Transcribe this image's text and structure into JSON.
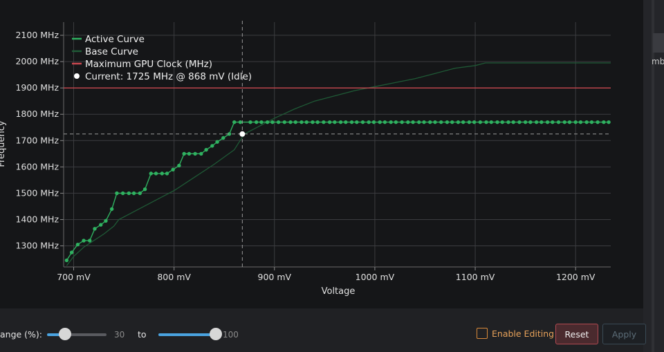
{
  "chart_data": {
    "type": "line",
    "xlabel": "Voltage",
    "ylabel": "Frequency",
    "x_unit": "mV",
    "y_unit": "MHz",
    "xlim": [
      690,
      1235
    ],
    "ylim": [
      1220,
      2150
    ],
    "x_ticks": [
      700,
      800,
      900,
      1000,
      1100,
      1200
    ],
    "y_ticks": [
      1300,
      1400,
      1500,
      1600,
      1700,
      1800,
      1900,
      2000,
      2100
    ],
    "x_tick_labels": [
      "700 mV",
      "800 mV",
      "900 mV",
      "1000 mV",
      "1100 mV",
      "1200 mV"
    ],
    "y_tick_labels": [
      "1300 MHz",
      "1400 MHz",
      "1500 MHz",
      "1600 MHz",
      "1700 MHz",
      "1800 MHz",
      "1900 MHz",
      "2000 MHz",
      "2100 MHz"
    ],
    "grid": true,
    "legend_position": "top-left",
    "legend": [
      {
        "label": "Active Curve",
        "color": "#2fb160"
      },
      {
        "label": "Base Curve",
        "color": "#1f5a36"
      },
      {
        "label": "Maximum GPU Clock (MHz)",
        "color": "#c9474f"
      },
      {
        "label": "Current: 1725 MHz @ 868 mV (Idle)",
        "color": "#ffffff"
      }
    ],
    "series": [
      {
        "name": "Active Curve",
        "color": "#2fb160",
        "x": [
          693,
          698,
          704,
          710,
          716,
          721,
          727,
          732,
          738,
          743,
          749,
          755,
          760,
          766,
          771,
          777,
          782,
          788,
          793,
          799,
          805,
          810,
          815,
          821,
          827,
          832,
          838,
          843,
          849,
          855,
          860,
          866,
          876,
          882,
          887,
          893,
          898,
          904,
          910,
          916,
          921,
          927,
          932,
          938,
          943,
          949,
          955,
          960,
          966,
          971,
          977,
          982,
          988,
          994,
          999,
          1005,
          1010,
          1016,
          1021,
          1027,
          1033,
          1038,
          1044,
          1049,
          1055,
          1060,
          1066,
          1072,
          1077,
          1083,
          1088,
          1094,
          1099,
          1105,
          1111,
          1116,
          1122,
          1127,
          1133,
          1138,
          1144,
          1150,
          1155,
          1161,
          1166,
          1172,
          1177,
          1183,
          1189,
          1194,
          1200,
          1205,
          1211,
          1216,
          1222,
          1228,
          1233
        ],
        "y": [
          1245,
          1275,
          1305,
          1320,
          1320,
          1365,
          1380,
          1395,
          1440,
          1500,
          1500,
          1500,
          1500,
          1500,
          1515,
          1575,
          1575,
          1575,
          1575,
          1590,
          1605,
          1650,
          1650,
          1650,
          1650,
          1665,
          1680,
          1695,
          1710,
          1725,
          1770,
          1770,
          1770,
          1770,
          1770,
          1770,
          1770,
          1770,
          1770,
          1770,
          1770,
          1770,
          1770,
          1770,
          1770,
          1770,
          1770,
          1770,
          1770,
          1770,
          1770,
          1770,
          1770,
          1770,
          1770,
          1770,
          1770,
          1770,
          1770,
          1770,
          1770,
          1770,
          1770,
          1770,
          1770,
          1770,
          1770,
          1770,
          1770,
          1770,
          1770,
          1770,
          1770,
          1770,
          1770,
          1770,
          1770,
          1770,
          1770,
          1770,
          1770,
          1770,
          1770,
          1770,
          1770,
          1770,
          1770,
          1770,
          1770,
          1770,
          1770,
          1770,
          1770,
          1770,
          1770,
          1770,
          1770
        ]
      },
      {
        "name": "Base Curve",
        "color": "#1f5a36",
        "x": [
          693,
          700,
          710,
          720,
          730,
          740,
          745,
          760,
          780,
          800,
          820,
          840,
          860,
          870,
          880,
          900,
          920,
          940,
          960,
          980,
          1000,
          1020,
          1040,
          1060,
          1080,
          1100,
          1110,
          1120,
          1140,
          1160,
          1180,
          1200,
          1220,
          1235
        ],
        "y": [
          1225,
          1260,
          1295,
          1320,
          1345,
          1375,
          1400,
          1430,
          1470,
          1510,
          1560,
          1610,
          1665,
          1725,
          1745,
          1785,
          1820,
          1850,
          1870,
          1890,
          1905,
          1920,
          1935,
          1955,
          1975,
          1985,
          1995,
          1995,
          1995,
          1995,
          1995,
          1995,
          1995,
          1995
        ]
      },
      {
        "name": "Maximum GPU Clock (MHz)",
        "color": "#c9474f",
        "x": [
          690,
          1235
        ],
        "y": [
          1900,
          1900
        ]
      }
    ],
    "current_point": {
      "x": 868,
      "y": 1725
    }
  },
  "controls": {
    "range_label": "ange (%):",
    "range_min_value": "30",
    "to_label": "to",
    "range_max_value": "100",
    "enable_editing_label": "Enable Editing",
    "reset_label": "Reset",
    "apply_label": "Apply"
  },
  "right_strip": {
    "cut_text": "mbe"
  }
}
